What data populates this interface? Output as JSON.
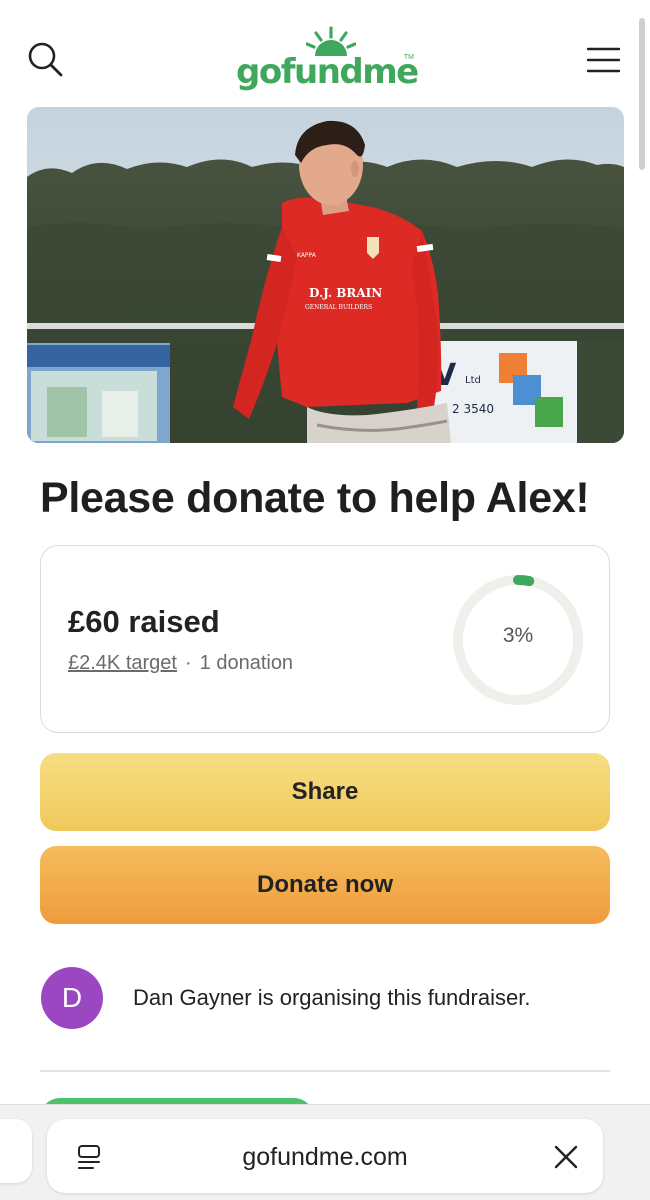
{
  "header": {
    "logo_text": "gofundme",
    "logo_tm": "TM",
    "brand_color": "#3fa85c",
    "search_icon": "search-icon",
    "menu_icon": "hamburger-menu-icon"
  },
  "hero": {
    "image": "photo of a footballer in a red kit on a grass pitch"
  },
  "campaign": {
    "title": "Please donate to help Alex!"
  },
  "progress": {
    "raised_label": "£60 raised",
    "target_label": "£2.4K target",
    "separator": "·",
    "donations_label": "1 donation",
    "percent_label": "3%",
    "percent_value": 0.03,
    "ring_color": "#3fa85c",
    "ring_track_color": "#f0efeb"
  },
  "actions": {
    "share_label": "Share",
    "donate_label": "Donate now"
  },
  "organiser": {
    "initial": "D",
    "avatar_color": "#9b47c2",
    "text": "Dan Gayner is organising this fundraiser."
  },
  "browser": {
    "url": "gofundme.com",
    "page_icon": "page-menu-icon",
    "close_icon": "close-icon"
  }
}
